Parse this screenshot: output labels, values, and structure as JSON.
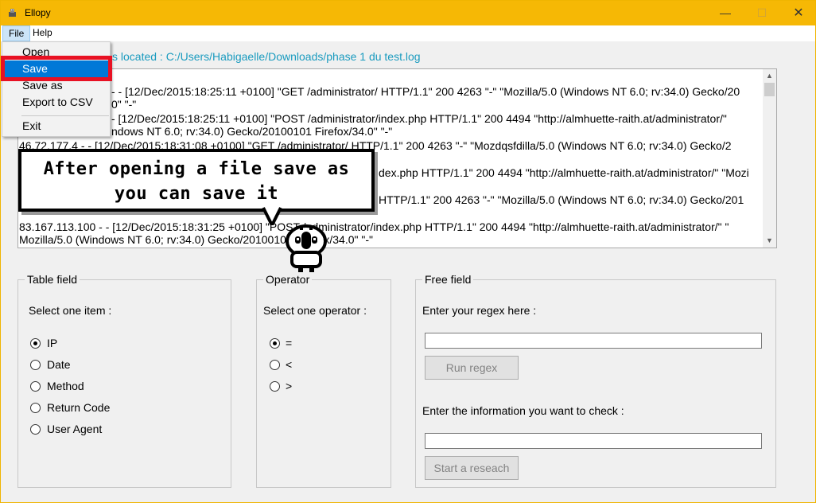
{
  "window": {
    "title": "Ellopy",
    "icon": "app-icon",
    "controls": {
      "minimize": "—",
      "maximize": "☐",
      "close": "✕"
    }
  },
  "menubar": {
    "items": [
      "File",
      "Help"
    ]
  },
  "file_menu": {
    "items": [
      "Open",
      "Save",
      "Save as",
      "Export to CSV",
      "Exit"
    ],
    "selected": "Save"
  },
  "file_path_text": "s located : C:/Users/Habigaelle/Downloads/phase 1 du test.log",
  "log_lines": [
    "- - [12/Dec/2015:18:25:11 +0100] \"GET /administrator/ HTTP/1.1\" 200 4263 \"-\" \"Mozilla/5.0 (Windows NT 6.0; rv:34.0) Gecko/20",
    "0\" \"-\"",
    "- [12/Dec/2015:18:25:11 +0100] \"POST /administrator/index.php HTTP/1.1\" 200 4494 \"http://almhuette-raith.at/administrator/\"",
    "ndows NT 6.0; rv:34.0) Gecko/20100101 Firefox/34.0\" \"-\"",
    "46.72.177.4 - - [12/Dec/2015:18:31:08 +0100] \"GET /administrator/ HTTP/1.1\" 200 4263 \"-\" \"Mozdqsfdilla/5.0 (Windows NT 6.0; rv:34.0) Gecko/2",
    "dex.php HTTP/1.1\" 200 4494 \"http://almhuette-raith.at/administrator/\" \"Mozi",
    "HTTP/1.1\" 200 4263 \"-\" \"Mozilla/5.0 (Windows NT 6.0; rv:34.0) Gecko/201",
    "83.167.113.100 - - [12/Dec/2015:18:31:25 +0100] \"POST /administrator/index.php HTTP/1.1\" 200 4494 \"http://almhuette-raith.at/administrator/\" \"",
    "Mozilla/5.0 (Windows NT 6.0; rv:34.0) Gecko/20100101 Firefox/34.0\" \"-\""
  ],
  "table_field": {
    "title": "Table field",
    "prompt": "Select one item :",
    "options": [
      "IP",
      "Date",
      "Method",
      "Return Code",
      "User Agent"
    ],
    "selected": "IP"
  },
  "operator": {
    "title": "Operator",
    "prompt": "Select one operator :",
    "options": [
      "=",
      "<",
      ">"
    ],
    "selected": "="
  },
  "free_field": {
    "title": "Free field",
    "regex_prompt": "Enter your regex here :",
    "regex_value": "",
    "run_button": "Run regex",
    "check_prompt": "Enter the information you want to check :",
    "check_value": "",
    "search_button": "Start a reseach"
  },
  "tooltip": {
    "line1": "After opening a file save as",
    "line2": "you can save it"
  },
  "colors": {
    "title_bar": "#f6b805",
    "menu_selection": "#0078d7",
    "highlight_box": "#e81123",
    "path_text": "#1a9bbf"
  }
}
